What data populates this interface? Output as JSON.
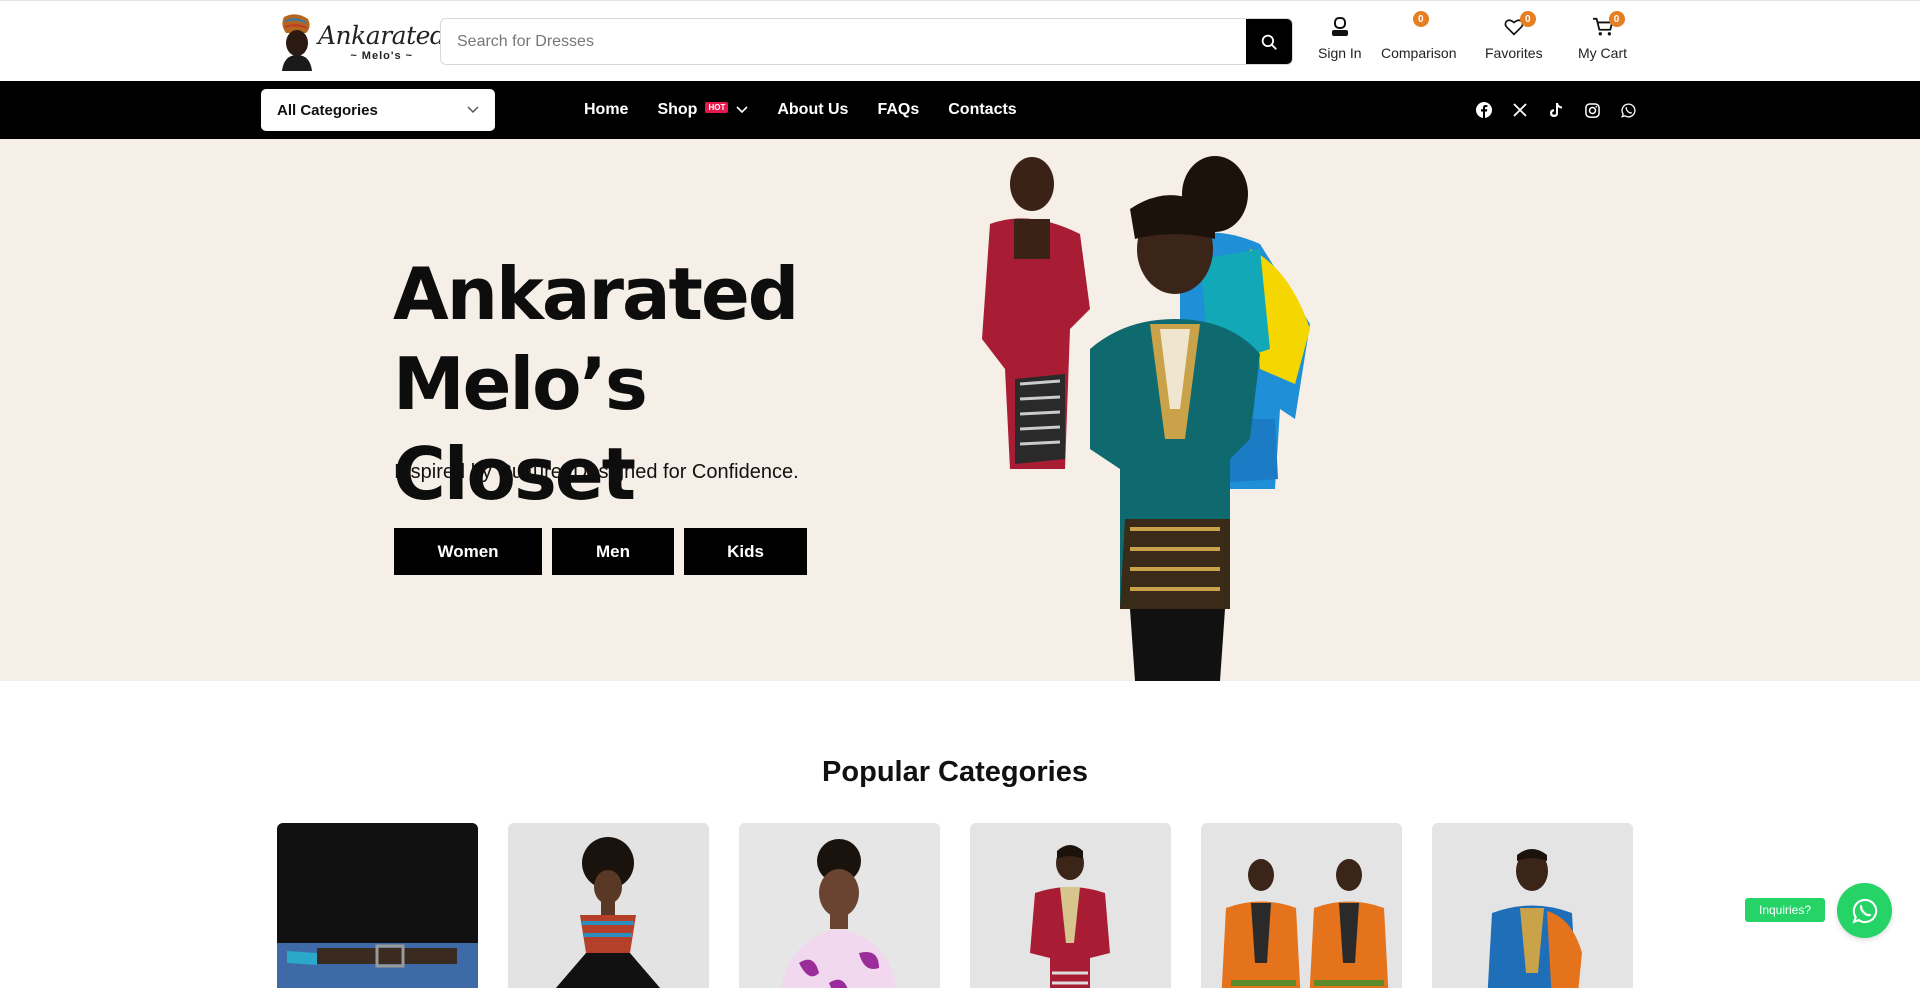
{
  "header": {
    "logo_script": "Ankarated",
    "logo_sub": "~ Melo's ~",
    "search_placeholder": "Search for Dresses",
    "signin_label": "Sign In",
    "comparison_label": "Comparison",
    "comparison_count": "0",
    "favorites_label": "Favorites",
    "favorites_count": "0",
    "cart_label": "My Cart",
    "cart_count": "0",
    "badge_color": "#e67e22"
  },
  "nav": {
    "category_select": "All Categories",
    "links": [
      "Home",
      "Shop",
      "About Us",
      "FAQs",
      "Contacts"
    ],
    "hot_badge": "HOT",
    "socials": [
      "facebook-icon",
      "x-icon",
      "tiktok-icon",
      "instagram-icon",
      "whatsapp-icon"
    ]
  },
  "hero": {
    "title_line1": "Ankarated",
    "title_line2": "Melo’s Closet",
    "tagline": "Inspired by Culture. Designed for Confidence.",
    "buttons": [
      "Women",
      "Men",
      "Kids"
    ],
    "background": "#f6efe7"
  },
  "popular": {
    "title": "Popular Categories"
  },
  "chat": {
    "inquiries_label": "Inquiries?",
    "color": "#25d366"
  }
}
